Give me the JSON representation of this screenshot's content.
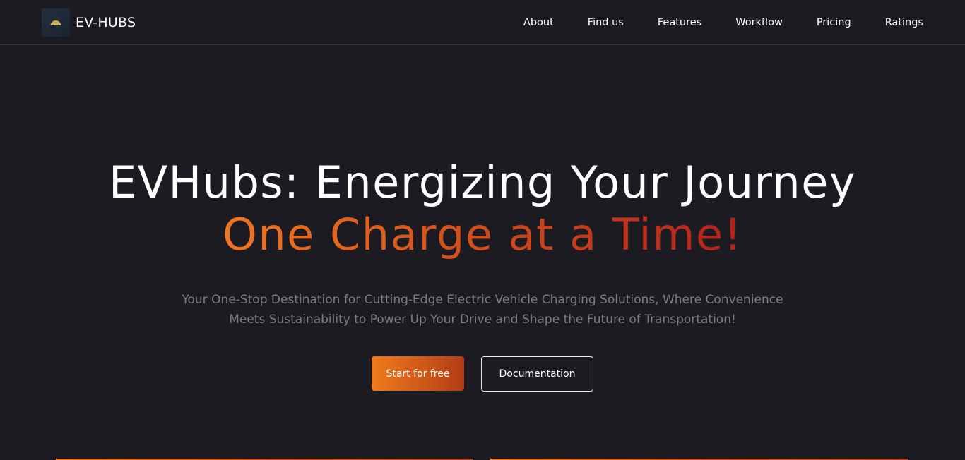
{
  "header": {
    "brand_name": "EV-HUBS",
    "nav": [
      {
        "label": "About"
      },
      {
        "label": "Find us"
      },
      {
        "label": "Features"
      },
      {
        "label": "Workflow"
      },
      {
        "label": "Pricing"
      },
      {
        "label": "Ratings"
      }
    ]
  },
  "hero": {
    "title_line1": "EVHubs: Energizing Your Journey",
    "title_line2": "One Charge at a Time!",
    "subtitle": "Your One-Stop Destination for Cutting-Edge Electric Vehicle Charging Solutions, Where Convenience Meets Sustainability to Power Up Your Drive and Shape the Future of Transportation!",
    "primary_button": "Start for free",
    "secondary_button": "Documentation"
  },
  "colors": {
    "background": "#1c1b21",
    "accent_start": "#f07620",
    "accent_end": "#b3201a",
    "subtitle_text": "#7d7c82"
  },
  "icons": {
    "logo": "ev-car-logo-icon"
  }
}
